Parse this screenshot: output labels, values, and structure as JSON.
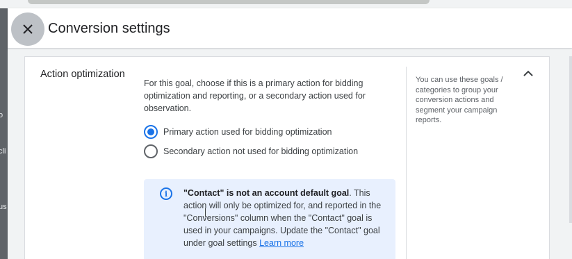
{
  "header": {
    "title": "Conversion settings",
    "close_icon": "close-icon"
  },
  "left_edge": {
    "fragments": [
      "o",
      "cli",
      "us"
    ]
  },
  "section": {
    "label": "Action optimization",
    "description": "For this goal, choose if this is a primary action for bidding optimization and reporting, or a secondary action used for observation.",
    "options": [
      {
        "label": "Primary action used for bidding optimization",
        "selected": true
      },
      {
        "label": "Secondary action not used for bidding optimization",
        "selected": false
      }
    ],
    "info": {
      "icon": "info-icon",
      "bold": "\"Contact\" is not an account default goal",
      "text": ". This action will only be optimized for, and reported in the \"Conversions\" column when the \"Contact\" goal is used in your campaigns. Update the \"Contact\" goal under goal settings ",
      "link": "Learn more"
    },
    "side_note": "You can use these goals / categories to group your conversion actions and segment your campaign reports.",
    "collapse_icon": "chevron-up-icon"
  },
  "colors": {
    "accent": "#1a73e8",
    "info_bg": "#e8f0fe",
    "close_bg": "#bdc1c6"
  }
}
